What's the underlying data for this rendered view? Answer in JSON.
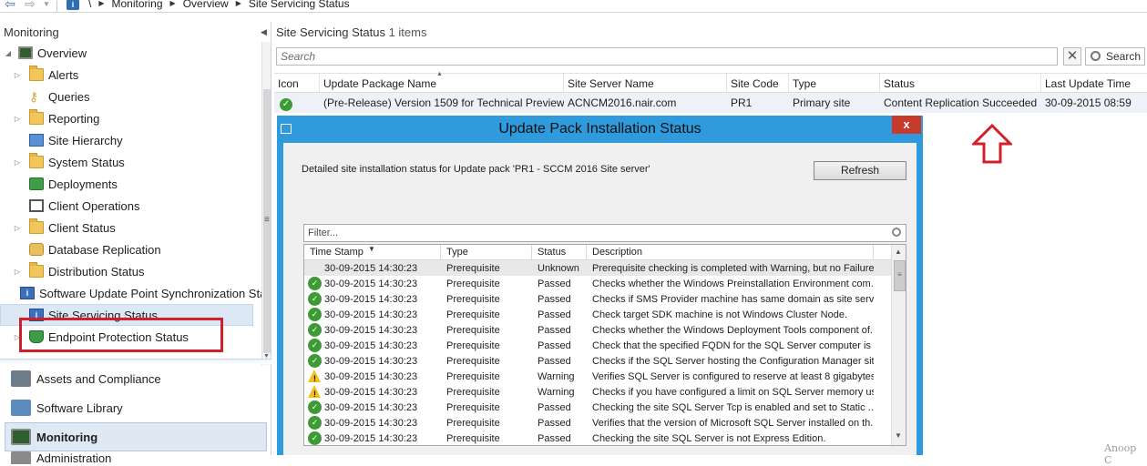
{
  "breadcrumb": {
    "sep": "\\",
    "items": [
      "Monitoring",
      "Overview",
      "Site Servicing Status"
    ]
  },
  "nav": {
    "header": "Monitoring",
    "items": [
      {
        "label": "Overview",
        "icon": "monitor-icon",
        "level": 0,
        "expander": "◢"
      },
      {
        "label": "Alerts",
        "icon": "folder-icon",
        "level": 1,
        "expander": "▷"
      },
      {
        "label": "Queries",
        "icon": "key-icon",
        "level": 1,
        "expander": ""
      },
      {
        "label": "Reporting",
        "icon": "folder-icon",
        "level": 1,
        "expander": "▷"
      },
      {
        "label": "Site Hierarchy",
        "icon": "hierarchy-icon",
        "level": 1,
        "expander": ""
      },
      {
        "label": "System Status",
        "icon": "folder-icon",
        "level": 1,
        "expander": "▷"
      },
      {
        "label": "Deployments",
        "icon": "deployments-icon",
        "level": 1,
        "expander": ""
      },
      {
        "label": "Client Operations",
        "icon": "client-operations-icon",
        "level": 1,
        "expander": ""
      },
      {
        "label": "Client Status",
        "icon": "folder-icon",
        "level": 1,
        "expander": "▷"
      },
      {
        "label": "Database Replication",
        "icon": "database-icon",
        "level": 1,
        "expander": ""
      },
      {
        "label": "Distribution Status",
        "icon": "folder-icon",
        "level": 1,
        "expander": "▷"
      },
      {
        "label": "Software Update Point Synchronization Sta",
        "icon": "sync-icon",
        "level": 1,
        "expander": ""
      },
      {
        "label": "Site Servicing Status",
        "icon": "site-servicing-icon",
        "level": 1,
        "expander": "",
        "selected": true
      },
      {
        "label": "Endpoint Protection Status",
        "icon": "shield-icon",
        "level": 1,
        "expander": "▷"
      }
    ],
    "workspaces": [
      {
        "label": "Assets and Compliance",
        "icon": "assets-icon"
      },
      {
        "label": "Software Library",
        "icon": "library-icon"
      },
      {
        "label": "Monitoring",
        "icon": "monitoring-icon",
        "active": true
      },
      {
        "label": "Administration",
        "icon": "admin-icon"
      }
    ]
  },
  "main": {
    "title": "Site Servicing Status",
    "count": "1 items",
    "search_placeholder": "Search",
    "search_button": "Search",
    "clear_glyph": "✕",
    "columns": [
      "Icon",
      "Update Package Name",
      "Site Server Name",
      "Site Code",
      "Type",
      "Status",
      "Last Update Time"
    ],
    "row": {
      "icon": "check-icon",
      "package": "(Pre-Release) Version 1509 for Technical Preview",
      "server": "ACNCM2016.nair.com",
      "site_code": "PR1",
      "type": "Primary site",
      "status": "Content Replication Succeeded",
      "last_update": "30-09-2015 08:59"
    }
  },
  "dialog": {
    "title": "Update Pack Installation Status",
    "close_glyph": "x",
    "description": "Detailed site installation status for Update pack 'PR1 - SCCM 2016 Site server'",
    "refresh_label": "Refresh",
    "filter_placeholder": "Filter...",
    "columns": [
      "Time Stamp",
      "Type",
      "Status",
      "Description"
    ],
    "rows": [
      {
        "icon": "none",
        "time": "30-09-2015 14:30:23",
        "type": "Prerequisite",
        "status": "Unknown",
        "desc": "Prerequisite checking is completed with Warning, but no Failure"
      },
      {
        "icon": "ok",
        "time": "30-09-2015 14:30:23",
        "type": "Prerequisite",
        "status": "Passed",
        "desc": "Checks whether the Windows Preinstallation Environment com..."
      },
      {
        "icon": "ok",
        "time": "30-09-2015 14:30:23",
        "type": "Prerequisite",
        "status": "Passed",
        "desc": "Checks if SMS Provider machine has same domain as site server."
      },
      {
        "icon": "ok",
        "time": "30-09-2015 14:30:23",
        "type": "Prerequisite",
        "status": "Passed",
        "desc": "Check target SDK machine is not Windows Cluster Node."
      },
      {
        "icon": "ok",
        "time": "30-09-2015 14:30:23",
        "type": "Prerequisite",
        "status": "Passed",
        "desc": "Checks whether the Windows Deployment Tools component of..."
      },
      {
        "icon": "ok",
        "time": "30-09-2015 14:30:23",
        "type": "Prerequisite",
        "status": "Passed",
        "desc": "Check that the specified FQDN for the SQL Server computer is ..."
      },
      {
        "icon": "ok",
        "time": "30-09-2015 14:30:23",
        "type": "Prerequisite",
        "status": "Passed",
        "desc": "Checks if the SQL Server hosting the Configuration Manager sit..."
      },
      {
        "icon": "warn",
        "time": "30-09-2015 14:30:23",
        "type": "Prerequisite",
        "status": "Warning",
        "desc": "Verifies SQL Server is configured to reserve at least 8 gigabytes..."
      },
      {
        "icon": "warn",
        "time": "30-09-2015 14:30:23",
        "type": "Prerequisite",
        "status": "Warning",
        "desc": "Checks if you have configured a limit on SQL Server memory us..."
      },
      {
        "icon": "ok",
        "time": "30-09-2015 14:30:23",
        "type": "Prerequisite",
        "status": "Passed",
        "desc": "Checking the site SQL Server Tcp is enabled and set to Static ..."
      },
      {
        "icon": "ok",
        "time": "30-09-2015 14:30:23",
        "type": "Prerequisite",
        "status": "Passed",
        "desc": "Verifies that the version of Microsoft SQL Server installed on th..."
      },
      {
        "icon": "ok",
        "time": "30-09-2015 14:30:23",
        "type": "Prerequisite",
        "status": "Passed",
        "desc": "Checking the site SQL Server is not Express Edition."
      }
    ]
  },
  "watermark": "Anoop C",
  "colors": {
    "highlight_red": "#d0202b",
    "dialog_frame": "#2f9bdc",
    "ok_green": "#3e9a35",
    "warn_yellow": "#f2c01e"
  }
}
